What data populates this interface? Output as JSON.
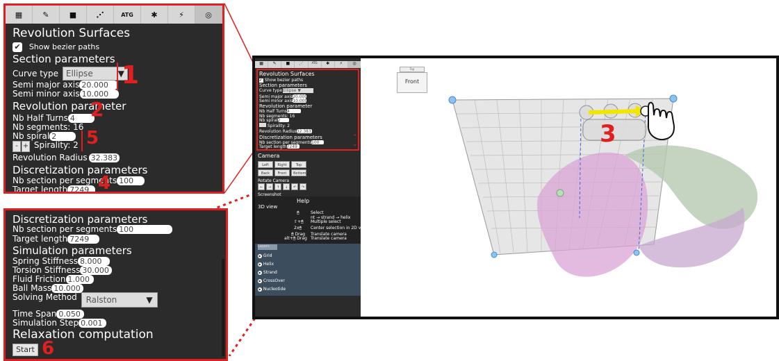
{
  "toolbar": {
    "icons": [
      "grid-icon",
      "pencil-icon",
      "camera-icon",
      "strand-icon",
      "atg-label",
      "gear-icon",
      "magic-wand-icon",
      "target-icon"
    ],
    "atg": "ATG"
  },
  "zoom_panel": {
    "title": "Revolution Surfaces",
    "show_bezier": "Show bezier paths",
    "section_params": "Section parameters",
    "curve_type_label": "Curve type",
    "curve_type_value": "Ellipse",
    "semi_major_label": "Semi major axis",
    "semi_major_value": "20.000",
    "semi_minor_label": "Semi minor axis",
    "semi_minor_value": "10.000",
    "revolution_param": "Revolution parameter",
    "nb_half_turns_label": "Nb Half Turns",
    "nb_half_turns_value": "4",
    "nb_segments": "Nb segments: 16",
    "nb_spiral_label": "Nb spiral",
    "nb_spiral_value": "2",
    "minus": "-",
    "plus": "+",
    "spirality": "Spirality: 2",
    "revolution_radius_label": "Revolution Radius",
    "revolution_radius_value": "32.383",
    "discretization": "Discretization parameters",
    "nb_section_label": "Nb section per segments",
    "nb_section_value": "100",
    "target_length_label": "Target length",
    "target_length_value": "7249"
  },
  "lower_panel": {
    "discretization": "Discretization parameters",
    "nb_section_label": "Nb section per segments",
    "nb_section_value": "100",
    "target_length_label": "Target length",
    "target_length_value": "7249",
    "simulation": "Simulation parameters",
    "spring_label": "Spring Stiffness",
    "spring_value": "8.000",
    "torsion_label": "Torsion Stiffness",
    "torsion_value": "30.000",
    "fluid_label": "Fluid Friction",
    "fluid_value": "1.000",
    "ball_label": "Ball Mass",
    "ball_value": "10.000",
    "solving_label": "Solving Method",
    "solving_value": "Ralston",
    "time_span_label": "Time Span",
    "time_span_value": "0.050",
    "sim_step_label": "Simulation Step",
    "sim_step_value": "0.001",
    "relaxation": "Relaxation computation",
    "start": "Start"
  },
  "annotations": {
    "n1": "1",
    "n2": "2",
    "n3": "3",
    "n4": "4",
    "n5": "5",
    "n6": "6"
  },
  "app": {
    "title": "Revolution Surfaces",
    "show_bezier": "Show bezier paths",
    "section_params": "Section parameters",
    "curve_type_label": "Curve type",
    "curve_type_value": "Ellipse",
    "semi_major_label": "Semi major axis",
    "semi_major_value": "20.000",
    "semi_minor_label": "Semi minor axis",
    "semi_minor_value": "10.000",
    "revolution_param": "Revolution parameter",
    "nb_half_turns_label": "Nb Half Turns",
    "nb_half_turns_value": "4",
    "nb_segments": "Nb segments: 16",
    "nb_spiral_label": "Nb spiral",
    "nb_spiral_value": "2",
    "spirality": "Spirality: 2",
    "revolution_radius_label": "Revolution Radius",
    "revolution_radius_value": "32.383",
    "discretization": "Discretization parameters",
    "nb_section_label": "Nb section per segments",
    "nb_section_value": "100",
    "target_length_label": "Target length",
    "target_length_value": "7249",
    "camera": "Camera",
    "cam_buttons": [
      "Left",
      "Right",
      "Top",
      "Back",
      "Front",
      "Bottom"
    ],
    "rotate_camera": "Rotate Camera",
    "screenshot": "Screenshot",
    "help": "Help",
    "view3d": "3D view",
    "help_rows": [
      {
        "key": "🖱",
        "desc": "Select"
      },
      {
        "key": "",
        "desc": "nt → strand → helix"
      },
      {
        "key": "⇧+🖱",
        "desc": "Multiple select"
      },
      {
        "key": "2x🖱",
        "desc": "Center selection in 2D view"
      },
      {
        "key": "🖱 Drag",
        "desc": "Translate camera"
      },
      {
        "key": "alt+🖱 Drag",
        "desc": "Translate camera"
      }
    ],
    "layers_header": "Layers",
    "layers": [
      "Grid",
      "Helix",
      "Strand",
      "CrossOver",
      "Nucleotide"
    ],
    "viewcube_top": "Top",
    "viewcube_front": "Front"
  }
}
